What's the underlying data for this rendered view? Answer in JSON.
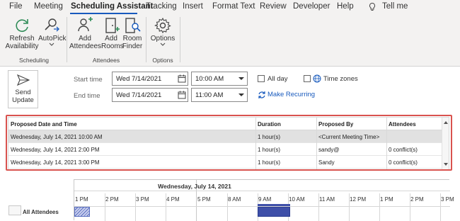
{
  "menu": {
    "tabs": [
      "File",
      "Meeting",
      "Scheduling Assistant",
      "Tracking",
      "Insert",
      "Format Text",
      "Review",
      "Developer",
      "Help"
    ],
    "active_tab": "Scheduling Assistant",
    "tell_me": "Tell me"
  },
  "ribbon": {
    "refresh": "Refresh Availability",
    "refresh_l1": "Refresh",
    "refresh_l2": "Availability",
    "autopick": "AutoPick",
    "add_attendees_l1": "Add",
    "add_attendees_l2": "Attendees",
    "add_rooms_l1": "Add",
    "add_rooms_l2": "Rooms",
    "room_finder_l1": "Room",
    "room_finder_l2": "Finder",
    "options": "Options",
    "group_scheduling": "Scheduling",
    "group_attendees": "Attendees",
    "group_options": "Options"
  },
  "form": {
    "send_l1": "Send",
    "send_l2": "Update",
    "start_time_label": "Start time",
    "end_time_label": "End time",
    "start_date": "Wed 7/14/2021",
    "start_time": "10:00 AM",
    "end_date": "Wed 7/14/2021",
    "end_time": "11:00 AM",
    "all_day": "All day",
    "time_zones": "Time zones",
    "make_recurring": "Make Recurring"
  },
  "proposals": {
    "headers": [
      "Proposed Date and Time",
      "Duration",
      "Proposed By",
      "Attendees"
    ],
    "rows": [
      [
        "Wednesday, July 14, 2021 10:00 AM",
        "1 hour(s)",
        "<Current Meeting Time>",
        ""
      ],
      [
        "Wednesday, July 14, 2021 2:00 PM",
        "1 hour(s)",
        "sandy@",
        "0 conflict(s)"
      ],
      [
        "Wednesday, July 14, 2021 3:00 PM",
        "1 hour(s)",
        "Sandy",
        "0 conflict(s)"
      ]
    ]
  },
  "schedule": {
    "date": "Wednesday, July 14, 2021",
    "hours": [
      "1 PM",
      "2 PM",
      "3 PM",
      "4 PM",
      "5 PM",
      "8 AM",
      "9 AM",
      "10 AM",
      "11 AM",
      "12 PM",
      "1 PM",
      "2 PM",
      "3 PM"
    ],
    "all_attendees": "All Attendees"
  },
  "colors": {
    "accent": "#185abd",
    "highlight_border": "#d9534f",
    "busy": "#3e4fa8"
  }
}
